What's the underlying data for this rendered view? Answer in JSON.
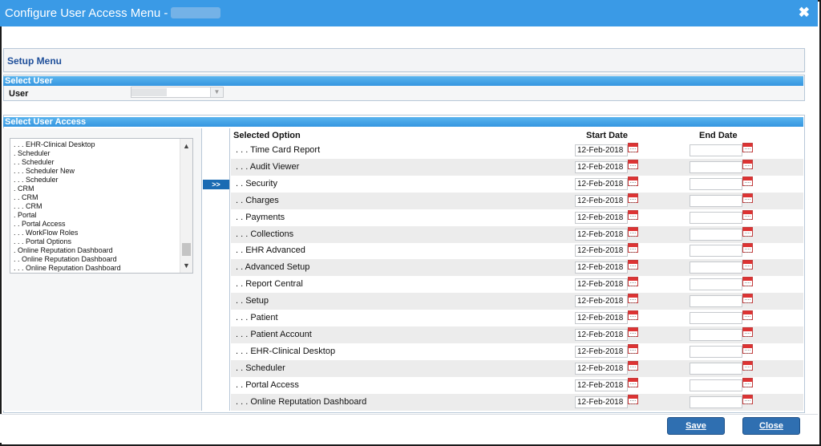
{
  "window": {
    "title": "Configure User Access Menu -"
  },
  "setup_menu": {
    "label": "Setup Menu"
  },
  "select_user": {
    "section_label": "Select User",
    "user_label": "User"
  },
  "select_access": {
    "section_label": "Select User Access",
    "move_button": ">>",
    "tree": [
      ". . . EHR-Clinical Desktop",
      ". Scheduler",
      ". . Scheduler",
      ". . . Scheduler New",
      ". . . Scheduler",
      ". CRM",
      ". . CRM",
      ". . . CRM",
      ". Portal",
      ". . Portal Access",
      ". . . WorkFlow Roles",
      ". . . Portal Options",
      ". Online Reputation Dashboard",
      ". . Online Reputation Dashboard",
      ". . . Online Reputation Dashboard"
    ]
  },
  "grid": {
    "col_option": "Selected Option",
    "col_start": "Start Date",
    "col_end": "End Date",
    "rows": [
      {
        "option": ". . . Time Card Report",
        "start": "12-Feb-2018",
        "end": ""
      },
      {
        "option": ". . . Audit Viewer",
        "start": "12-Feb-2018",
        "end": ""
      },
      {
        "option": ". . Security",
        "start": "12-Feb-2018",
        "end": ""
      },
      {
        "option": ". . Charges",
        "start": "12-Feb-2018",
        "end": ""
      },
      {
        "option": ". . Payments",
        "start": "12-Feb-2018",
        "end": ""
      },
      {
        "option": ". . . Collections",
        "start": "12-Feb-2018",
        "end": ""
      },
      {
        "option": ". . EHR Advanced",
        "start": "12-Feb-2018",
        "end": ""
      },
      {
        "option": ". . Advanced Setup",
        "start": "12-Feb-2018",
        "end": ""
      },
      {
        "option": ". . Report Central",
        "start": "12-Feb-2018",
        "end": ""
      },
      {
        "option": ". . Setup",
        "start": "12-Feb-2018",
        "end": ""
      },
      {
        "option": ". . . Patient",
        "start": "12-Feb-2018",
        "end": ""
      },
      {
        "option": ". . . Patient Account",
        "start": "12-Feb-2018",
        "end": ""
      },
      {
        "option": ". . . EHR-Clinical Desktop",
        "start": "12-Feb-2018",
        "end": ""
      },
      {
        "option": ". . Scheduler",
        "start": "12-Feb-2018",
        "end": ""
      },
      {
        "option": ". . Portal Access",
        "start": "12-Feb-2018",
        "end": ""
      },
      {
        "option": ". . . Online Reputation Dashboard",
        "start": "12-Feb-2018",
        "end": ""
      }
    ]
  },
  "buttons": {
    "save": "Save",
    "close": "Close"
  },
  "colors": {
    "titlebar": "#3a9ae6",
    "section_header": "#3596e0",
    "button": "#2f6fb1",
    "calendar_icon": "#dd3333"
  }
}
